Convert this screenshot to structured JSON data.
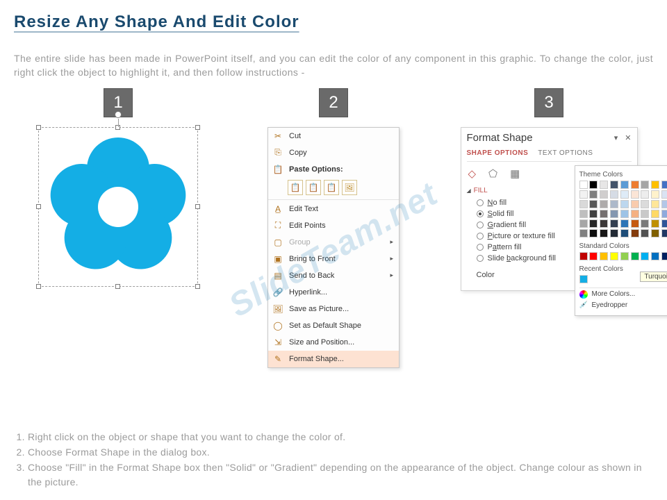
{
  "title": "Resize Any Shape And Edit Color",
  "intro": "The entire slide has been made in PowerPoint itself, and you can edit the color of any component in this graphic. To change the color, just right click the object to highlight it, and then follow instructions -",
  "badges": {
    "one": "1",
    "two": "2",
    "three": "3"
  },
  "watermark": "SlideTeam.net",
  "context_menu": {
    "cut": "Cut",
    "copy": "Copy",
    "paste_options": "Paste Options:",
    "edit_text": "Edit Text",
    "edit_points": "Edit Points",
    "group": "Group",
    "bring_to_front": "Bring to Front",
    "send_to_back": "Send to Back",
    "hyperlink": "Hyperlink...",
    "save_as_picture": "Save as Picture...",
    "set_default": "Set as Default Shape",
    "size_position": "Size and Position...",
    "format_shape": "Format Shape..."
  },
  "format_pane": {
    "title": "Format Shape",
    "tab_shape": "SHAPE OPTIONS",
    "tab_text": "TEXT OPTIONS",
    "section_fill": "FILL",
    "no_fill": "No fill",
    "solid_fill": "Solid fill",
    "gradient_fill": "Gradient fill",
    "picture_fill": "Picture or texture fill",
    "pattern_fill": "Pattern fill",
    "slide_bg_fill": "Slide background fill",
    "color_label": "Color"
  },
  "color_popup": {
    "theme": "Theme Colors",
    "standard": "Standard Colors",
    "recent": "Recent Colors",
    "more": "More Colors...",
    "eyedropper": "Eyedropper",
    "tooltip": "Turquoise",
    "theme_grid": [
      "#ffffff",
      "#000000",
      "#e7e6e6",
      "#44546a",
      "#5b9bd5",
      "#ed7d31",
      "#a5a5a5",
      "#ffc000",
      "#4472c4",
      "#70ad47",
      "#f2f2f2",
      "#7f7f7f",
      "#d0cece",
      "#d6dce5",
      "#deebf7",
      "#fbe5d6",
      "#ededed",
      "#fff2cc",
      "#dae3f3",
      "#e2f0d9",
      "#d9d9d9",
      "#595959",
      "#aeabab",
      "#adb9ca",
      "#bdd7ee",
      "#f8cbad",
      "#dbdbdb",
      "#ffe699",
      "#b4c7e7",
      "#c5e0b4",
      "#bfbfbf",
      "#404040",
      "#757070",
      "#8497b0",
      "#9dc3e6",
      "#f4b183",
      "#c9c9c9",
      "#ffd966",
      "#8faadc",
      "#a9d18e",
      "#a6a6a6",
      "#262626",
      "#3b3838",
      "#333f50",
      "#2e75b6",
      "#c55a11",
      "#7b7b7b",
      "#bf9000",
      "#2f5597",
      "#548235",
      "#808080",
      "#0d0d0d",
      "#171616",
      "#222a35",
      "#1f4e79",
      "#843c0c",
      "#525252",
      "#806000",
      "#203864",
      "#385723"
    ],
    "standard_row": [
      "#c00000",
      "#ff0000",
      "#ffc000",
      "#ffff00",
      "#92d050",
      "#00b050",
      "#00b0f0",
      "#0070c0",
      "#002060",
      "#7030a0"
    ],
    "recent_row": [
      "#14aee5"
    ]
  },
  "footer": {
    "l1": "Right click on the object or shape that you want to change the color of.",
    "l2": "Choose Format Shape in the dialog box.",
    "l3": "Choose \"Fill\" in the Format Shape box then \"Solid\" or \"Gradient\" depending on the appearance of the object. Change colour as shown in the picture."
  }
}
